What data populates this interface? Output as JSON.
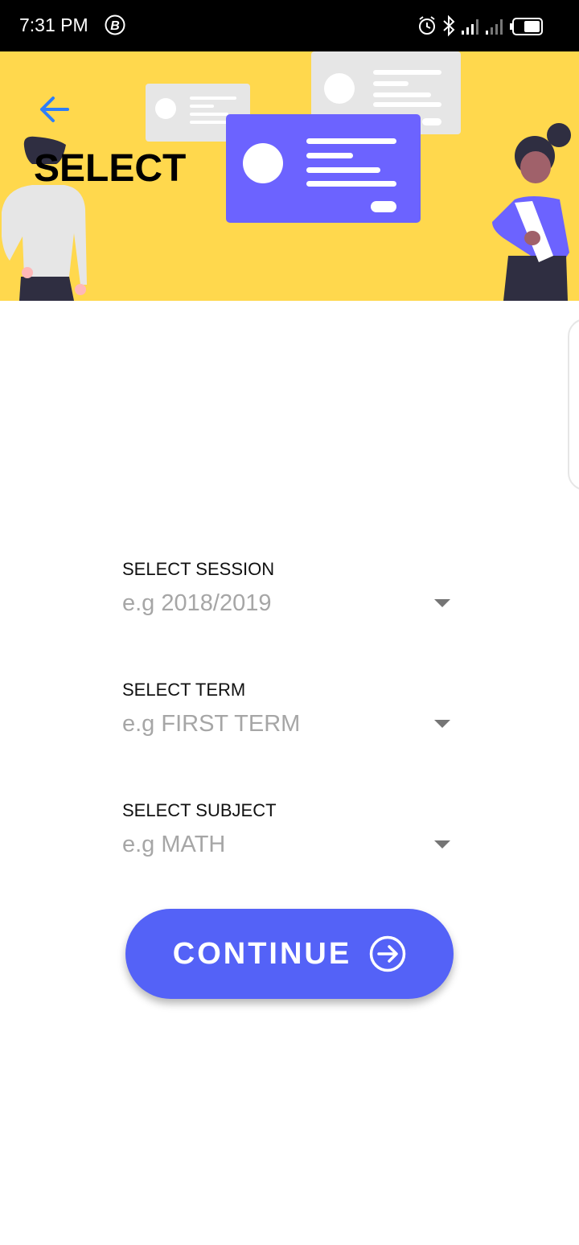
{
  "status_bar": {
    "time": "7:31 PM",
    "left_icon": "b-circle-icon",
    "right_icons": [
      "alarm-icon",
      "bluetooth-icon",
      "signal-icon",
      "signal-icon",
      "battery-icon"
    ]
  },
  "header": {
    "title": "SELECT",
    "back_icon": "arrow-left-icon",
    "background_color": "#FFD84D",
    "card_accent_color": "#6C63FF"
  },
  "form": {
    "session": {
      "label": "SELECT SESSION",
      "placeholder": "e.g 2018/2019"
    },
    "term": {
      "label": "SELECT TERM",
      "placeholder": "e.g FIRST TERM"
    },
    "subject": {
      "label": "SELECT SUBJECT",
      "placeholder": "e.g MATH"
    }
  },
  "continue_button": {
    "label": "CONTINUE",
    "icon": "arrow-right-circle-icon",
    "color": "#5462F7"
  }
}
